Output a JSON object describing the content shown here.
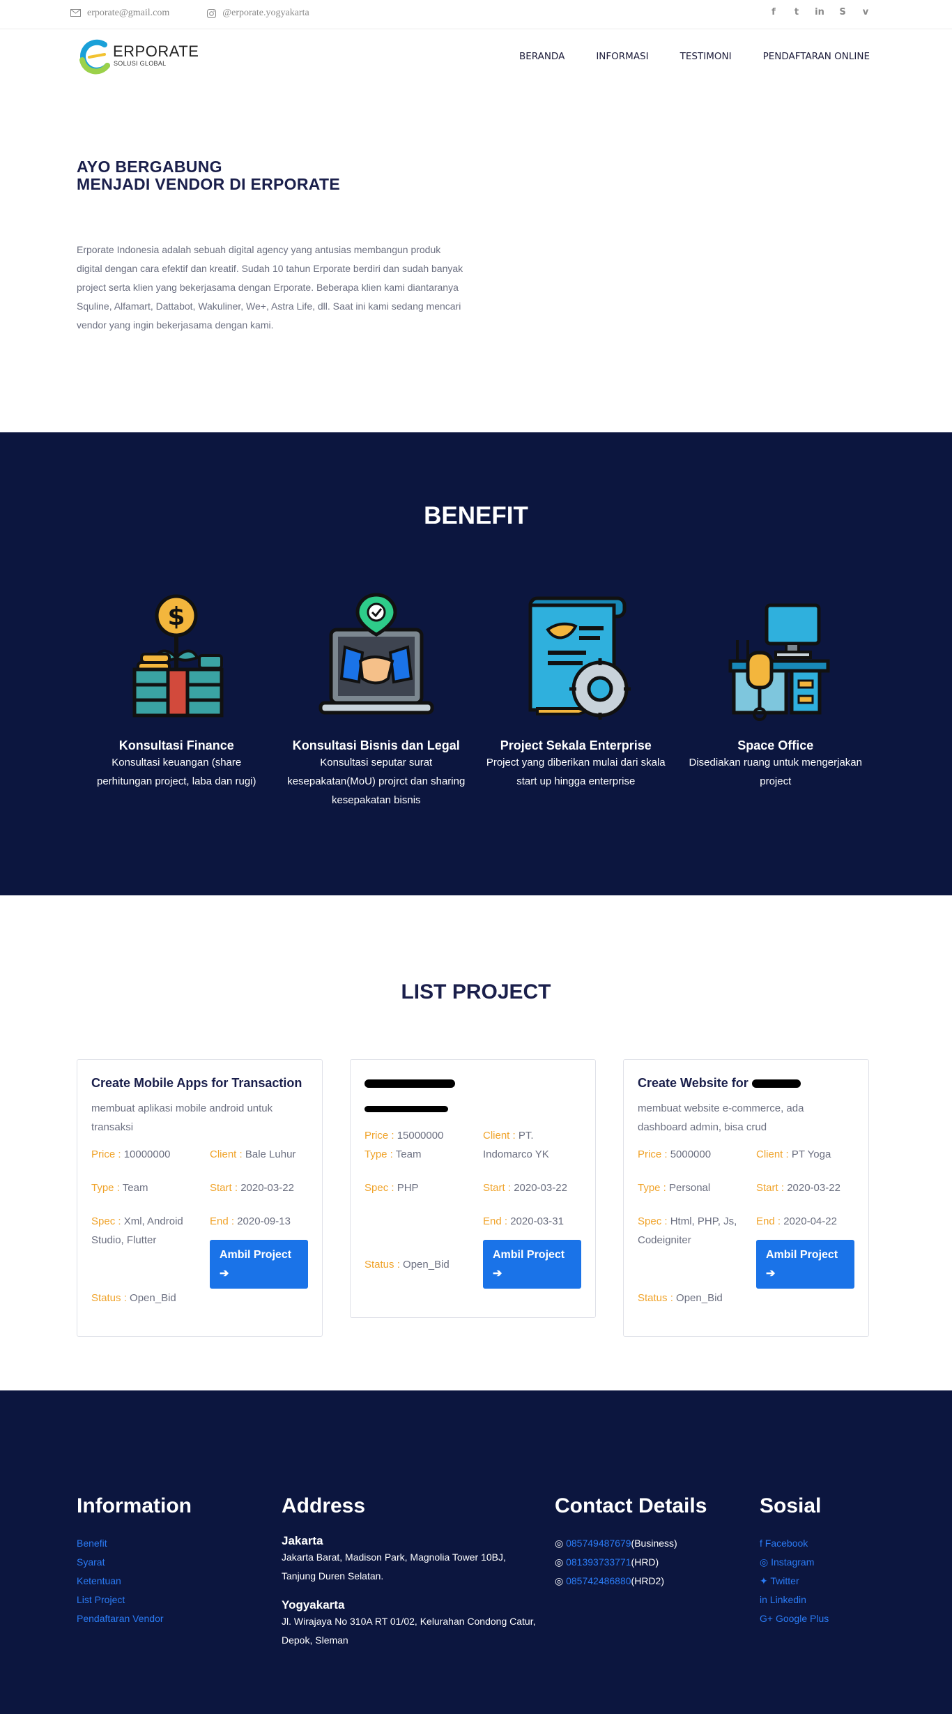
{
  "topbar": {
    "email": "erporate@gmail.com",
    "instagram": "@erporate.yogyakarta",
    "social_icons": [
      "facebook-icon",
      "twitter-icon",
      "linkedin-icon",
      "skype-icon",
      "vimeo-icon"
    ]
  },
  "nav": {
    "logo_title": "ERPORATE",
    "logo_sub": "SOLUSI GLOBAL",
    "items": [
      "BERANDA",
      "INFORMASI",
      "TESTIMONI",
      "PENDAFTARAN ONLINE"
    ]
  },
  "hero": {
    "title_line1": "AYO BERGABUNG",
    "title_line2": "MENJADI VENDOR DI ERPORATE",
    "description": "Erporate Indonesia adalah sebuah digital agency yang antusias membangun produk digital dengan cara efektif dan kreatif. Sudah 10 tahun Erporate berdiri dan sudah banyak project serta klien yang bekerjasama dengan Erporate. Beberapa klien kami diantaranya Squline, Alfamart, Dattabot, Wakuliner, We+, Astra Life, dll. Saat ini kami sedang mencari vendor yang ingin bekerjasama dengan kami."
  },
  "benefit": {
    "heading": "BENEFIT",
    "items": [
      {
        "title": "Konsultasi Finance",
        "desc": "Konsultasi keuangan (share perhitungan project, laba dan rugi)",
        "icon": "finance-icon"
      },
      {
        "title": "Konsultasi Bisnis dan Legal",
        "desc": "Konsultasi seputar surat kesepakatan(MoU) projrct dan sharing kesepakatan bisnis",
        "icon": "handshake-laptop-icon"
      },
      {
        "title": "Project Sekala Enterprise",
        "desc": "Project yang diberikan mulai dari skala start up hingga enterprise",
        "icon": "document-gear-icon"
      },
      {
        "title": "Space Office",
        "desc": "Disediakan ruang untuk mengerjakan project",
        "icon": "office-desk-icon"
      }
    ]
  },
  "projects": {
    "heading": "LIST PROJECT",
    "labels": {
      "price": "Price :",
      "client": "Client :",
      "type": "Type :",
      "start": "Start :",
      "spec": "Spec :",
      "end": "End :",
      "status": "Status :"
    },
    "button": "Ambil Project",
    "cards": [
      {
        "title": "Create Mobile Apps for Transaction",
        "desc": "membuat aplikasi mobile android untuk transaksi",
        "price": "10000000",
        "client": "Bale Luhur",
        "type": "Team",
        "start": "2020-03-22",
        "spec": "Xml, Android Studio, Flutter",
        "end": "2020-09-13",
        "status": "Open_Bid"
      },
      {
        "title": "",
        "desc": "",
        "price": "15000000",
        "client": "PT. Indomarco YK",
        "type": "Team",
        "start": "2020-03-22",
        "spec": "PHP",
        "end": "2020-03-31",
        "status": "Open_Bid"
      },
      {
        "title": "Create Website for",
        "desc": "membuat website e-commerce, ada dashboard admin, bisa crud",
        "price": "5000000",
        "client": "PT Yoga",
        "type": "Personal",
        "start": "2020-03-22",
        "spec": "Html, PHP, Js, Codeigniter",
        "end": "2020-04-22",
        "status": "Open_Bid"
      }
    ]
  },
  "footer": {
    "information": {
      "heading": "Information",
      "links": [
        "Benefit",
        "Syarat",
        "Ketentuan",
        "List Project",
        "Pendaftaran Vendor"
      ]
    },
    "address": {
      "heading": "Address",
      "jakarta_title": "Jakarta",
      "jakarta_addr": "Jakarta Barat, Madison Park, Magnolia Tower 10BJ, Tanjung Duren Selatan.",
      "yogya_title": "Yogyakarta",
      "yogya_addr": "Jl. Wirajaya No 310A RT 01/02, Kelurahan Condong Catur, Depok, Sleman"
    },
    "contact": {
      "heading": "Contact Details",
      "items": [
        {
          "number": "085749487679",
          "label": "(Business)"
        },
        {
          "number": "081393733771",
          "label": "(HRD)"
        },
        {
          "number": "085742486880",
          "label": "(HRD2)"
        }
      ]
    },
    "social": {
      "heading": "Sosial",
      "links": [
        "Facebook",
        "Instagram",
        "Twitter",
        "Linkedin",
        "Google Plus"
      ]
    }
  }
}
